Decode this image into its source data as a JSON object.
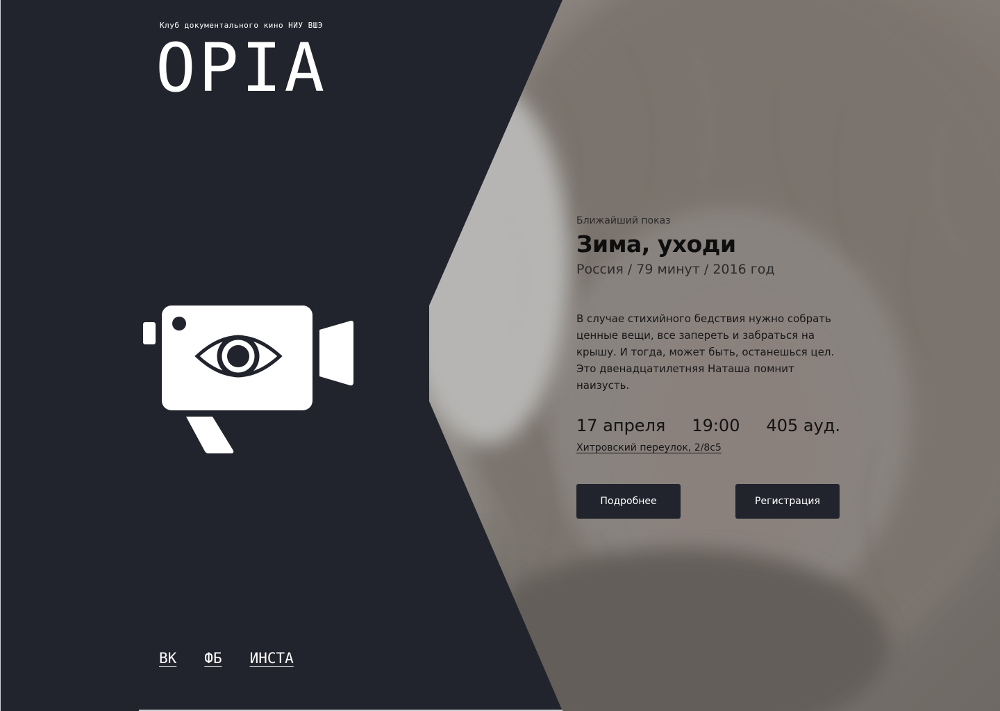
{
  "club": {
    "subtitle": "Клуб документального кино НИУ ВШЭ",
    "logo": "OPIA"
  },
  "icons": {
    "camera": "camera-with-eye-icon"
  },
  "social": [
    {
      "label": "ВК"
    },
    {
      "label": "ФБ"
    },
    {
      "label": "ИНСТА"
    }
  ],
  "screening": {
    "label": "Ближайший показ",
    "title": "Зима, уходи",
    "meta": "Россия / 79 минут / 2016 год",
    "description": "В случае стихийного бедствия нужно собрать ценные вещи, все запереть и забраться на крышу. И тогда, может быть, останешься цел. Это двенадцатилетняя Наташа помнит наизусть.",
    "date": "17 апреля",
    "time": "19:00",
    "room": "405 ауд.",
    "address": "Хитровский переулок, 2/8с5"
  },
  "buttons": {
    "details": "Подробнее",
    "register": "Регистрация"
  },
  "colors": {
    "panel": "#22242d",
    "text_light": "#ffffff",
    "button_bg": "#22242d"
  }
}
